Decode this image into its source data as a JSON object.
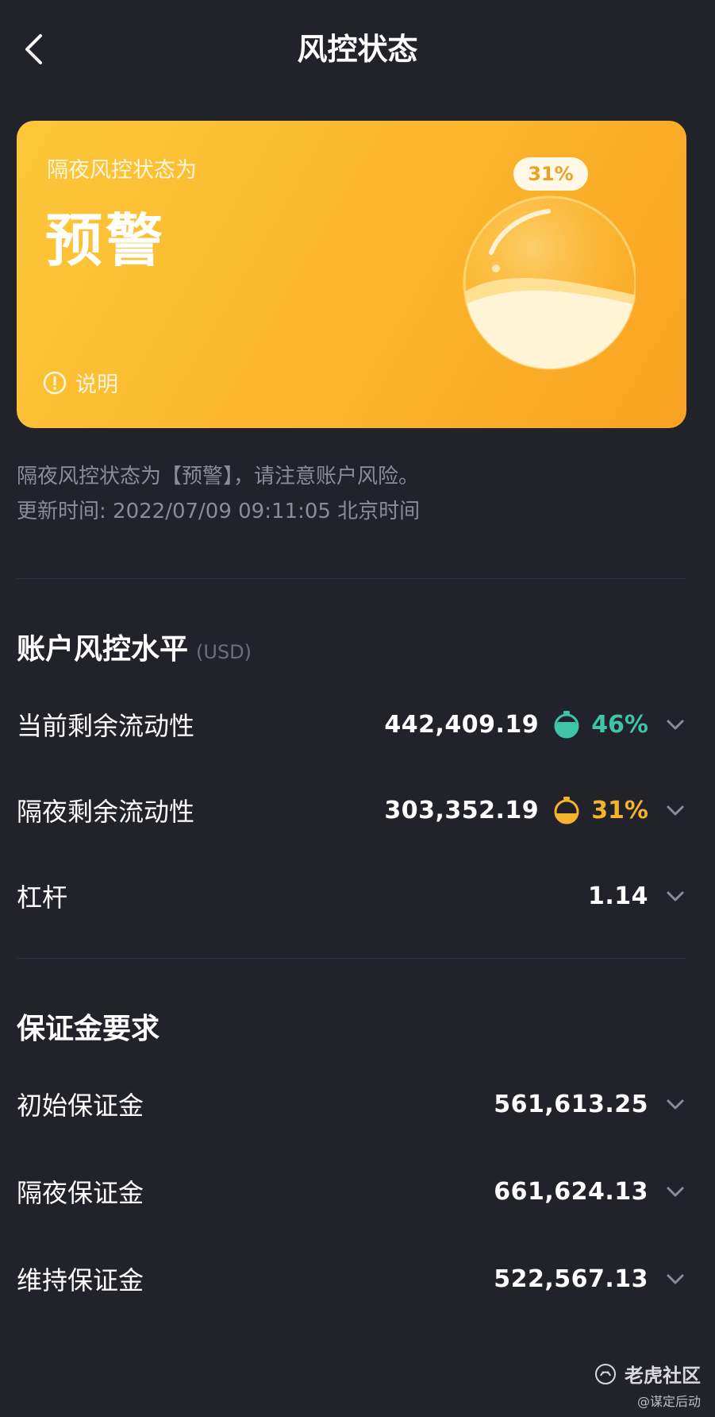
{
  "header": {
    "title": "风控状态"
  },
  "card": {
    "subtitle": "隔夜风控状态为",
    "status": "预警",
    "percent": "31%",
    "fill_level": 0.31,
    "help_label": "说明",
    "colors": {
      "start": "#fcc73a",
      "end": "#f9a323"
    }
  },
  "info": {
    "notice": "隔夜风控状态为【预警】，请注意账户风险。",
    "updated": "更新时间: 2022/07/09 09:11:05 北京时间"
  },
  "risk_section": {
    "title": "账户风控水平",
    "unit": "(USD)",
    "rows": [
      {
        "label": "当前剩余流动性",
        "value": "442,409.19",
        "percent": "46%",
        "color": "#3ec4a6",
        "icon": "gauge-icon"
      },
      {
        "label": "隔夜剩余流动性",
        "value": "303,352.19",
        "percent": "31%",
        "color": "#f4b32c",
        "icon": "gauge-icon"
      },
      {
        "label": "杠杆",
        "value": "1.14"
      }
    ]
  },
  "margin_section": {
    "title": "保证金要求",
    "rows": [
      {
        "label": "初始保证金",
        "value": "561,613.25"
      },
      {
        "label": "隔夜保证金",
        "value": "661,624.13"
      },
      {
        "label": "维持保证金",
        "value": "522,567.13"
      }
    ]
  },
  "watermark": {
    "brand": "老虎社区",
    "author": "@谋定后动"
  }
}
